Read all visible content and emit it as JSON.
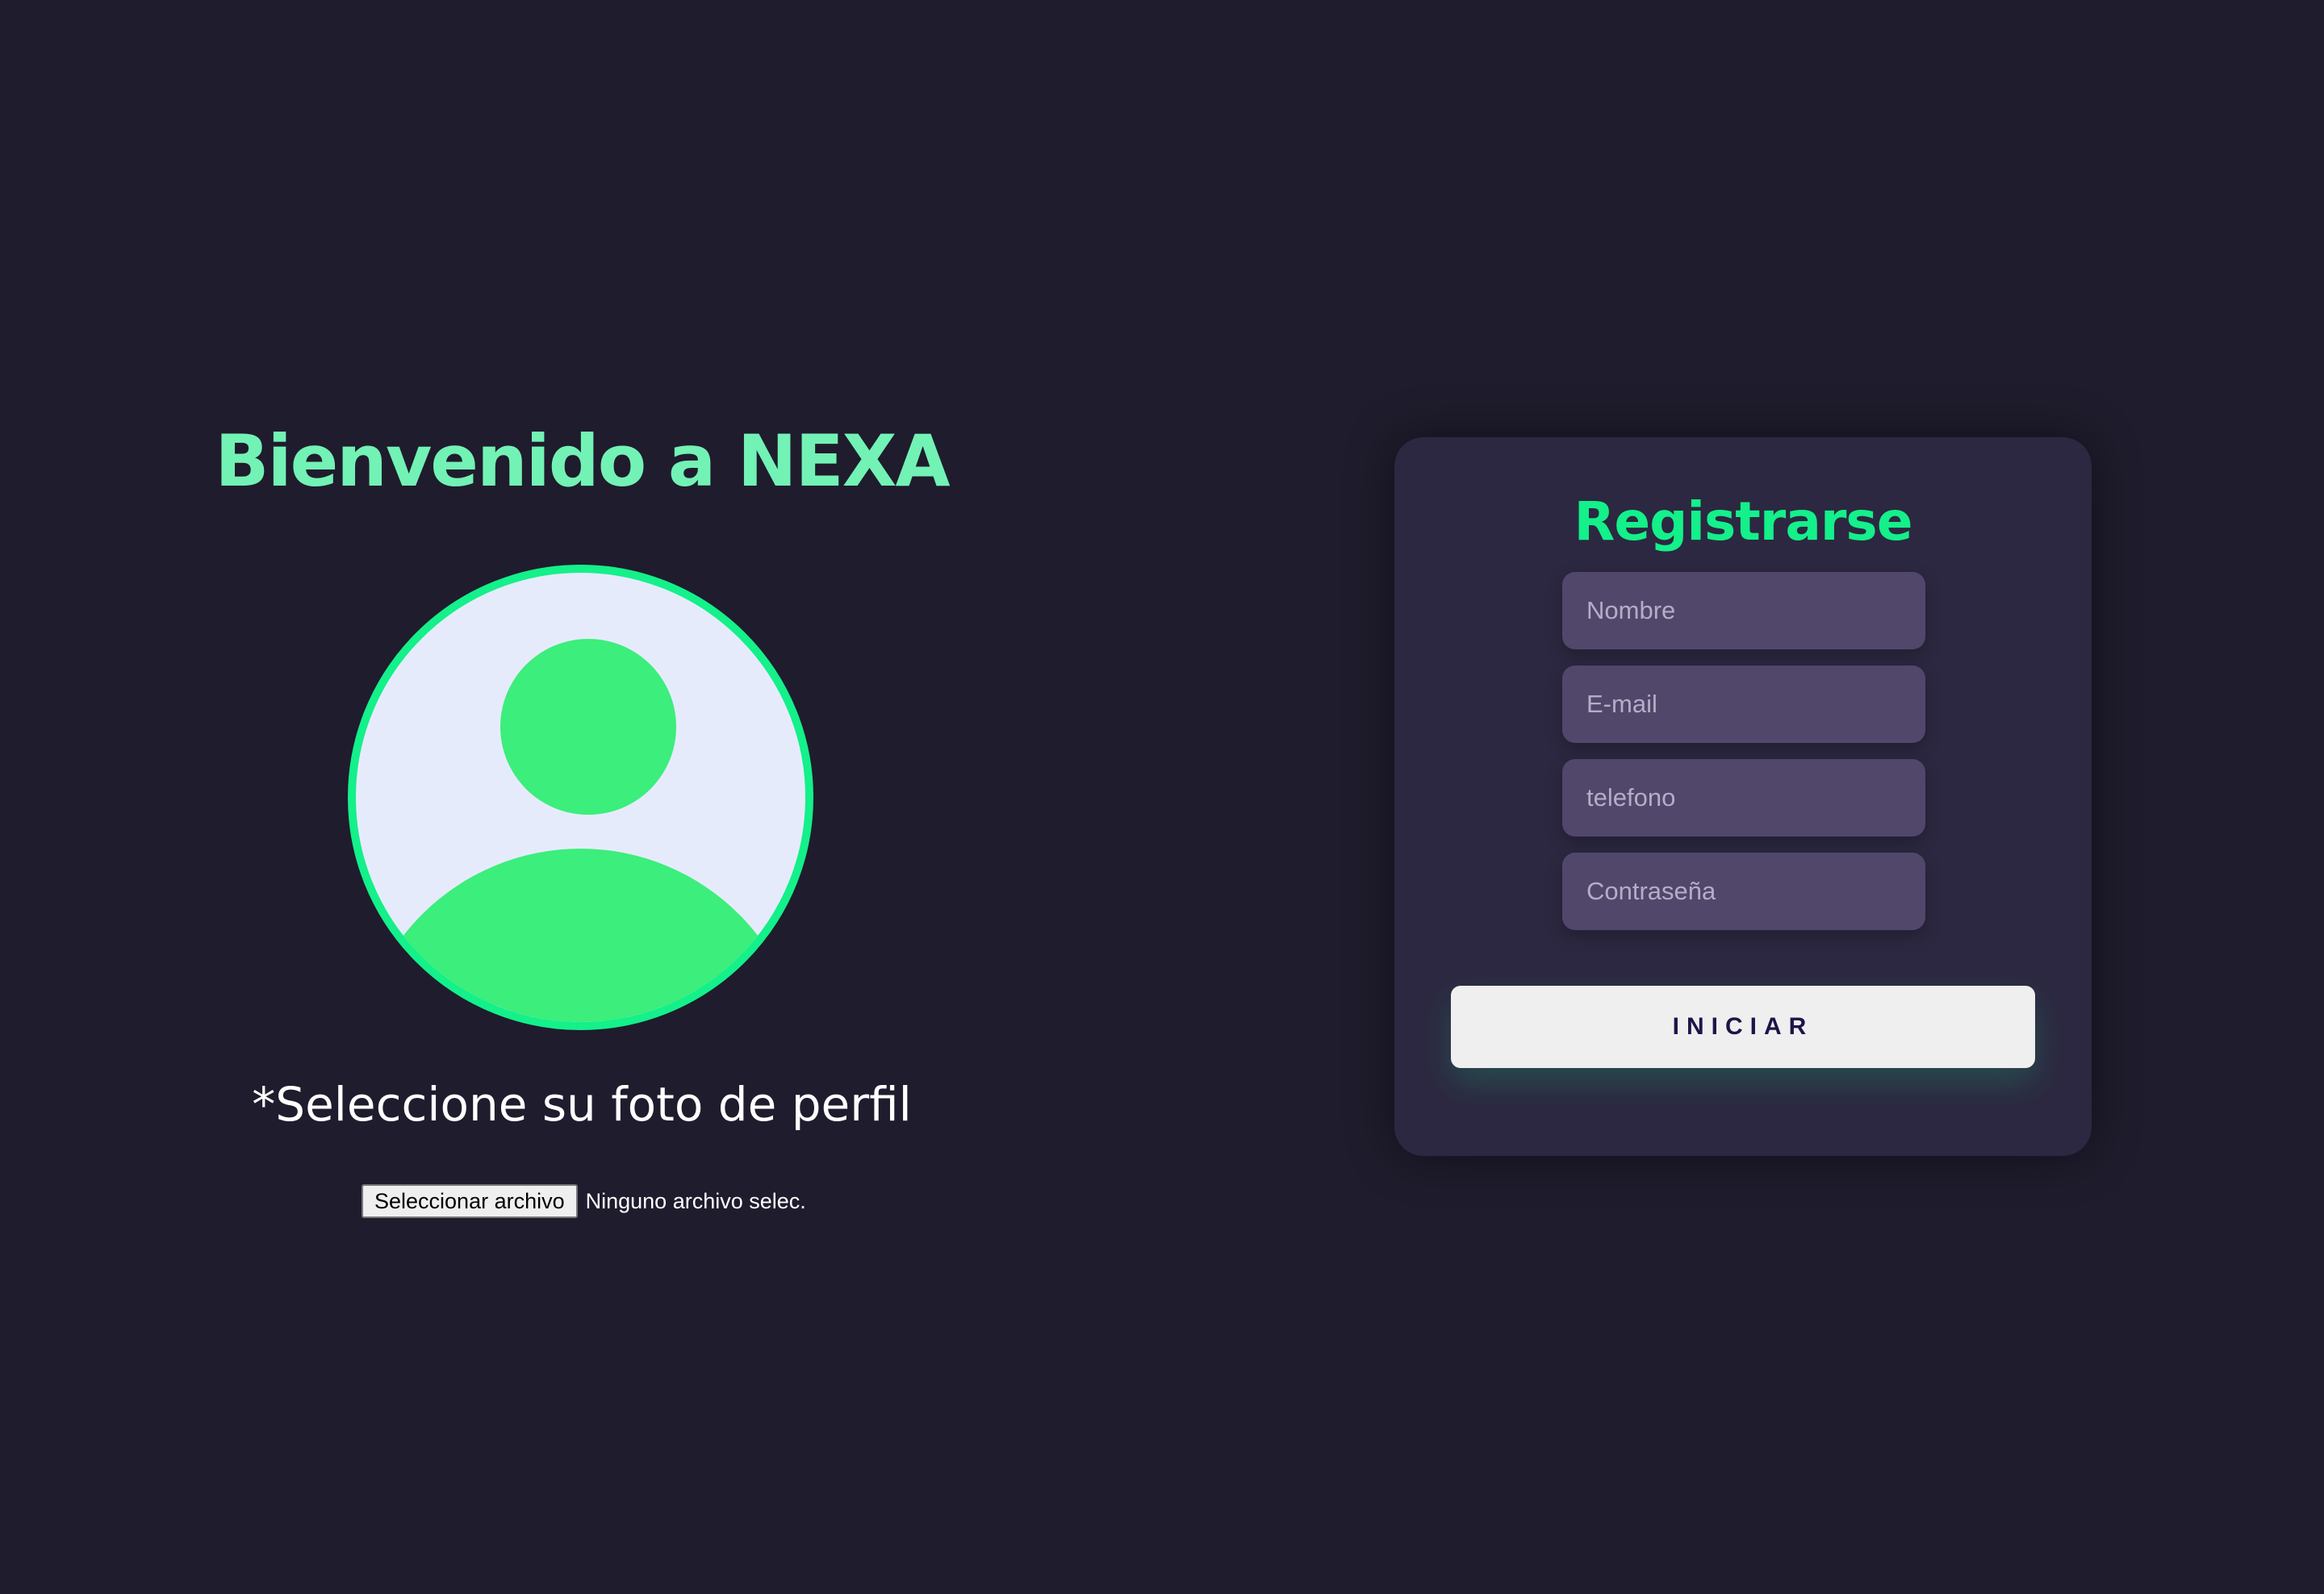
{
  "welcome": {
    "title": "Bienvenido a NEXA",
    "photo_prompt": "*Seleccione su foto de perfil",
    "file_button_label": "Seleccionar archivo",
    "file_status": "Ninguno archivo selec."
  },
  "register": {
    "title": "Registrarse",
    "fields": [
      {
        "placeholder": "Nombre",
        "value": ""
      },
      {
        "placeholder": "E-mail",
        "value": ""
      },
      {
        "placeholder": "telefono",
        "value": ""
      },
      {
        "placeholder": "Contraseña",
        "value": ""
      }
    ],
    "submit_label": "INICIAR"
  },
  "colors": {
    "background": "#1f1c2d",
    "card": "#2c2841",
    "accent": "#14f08a",
    "title_light": "#73f2b5",
    "field": "#51476b",
    "avatar_bg": "#e6ebfc",
    "avatar_fg": "#3cee7b"
  },
  "icons": {
    "avatar": "user-placeholder-icon"
  }
}
